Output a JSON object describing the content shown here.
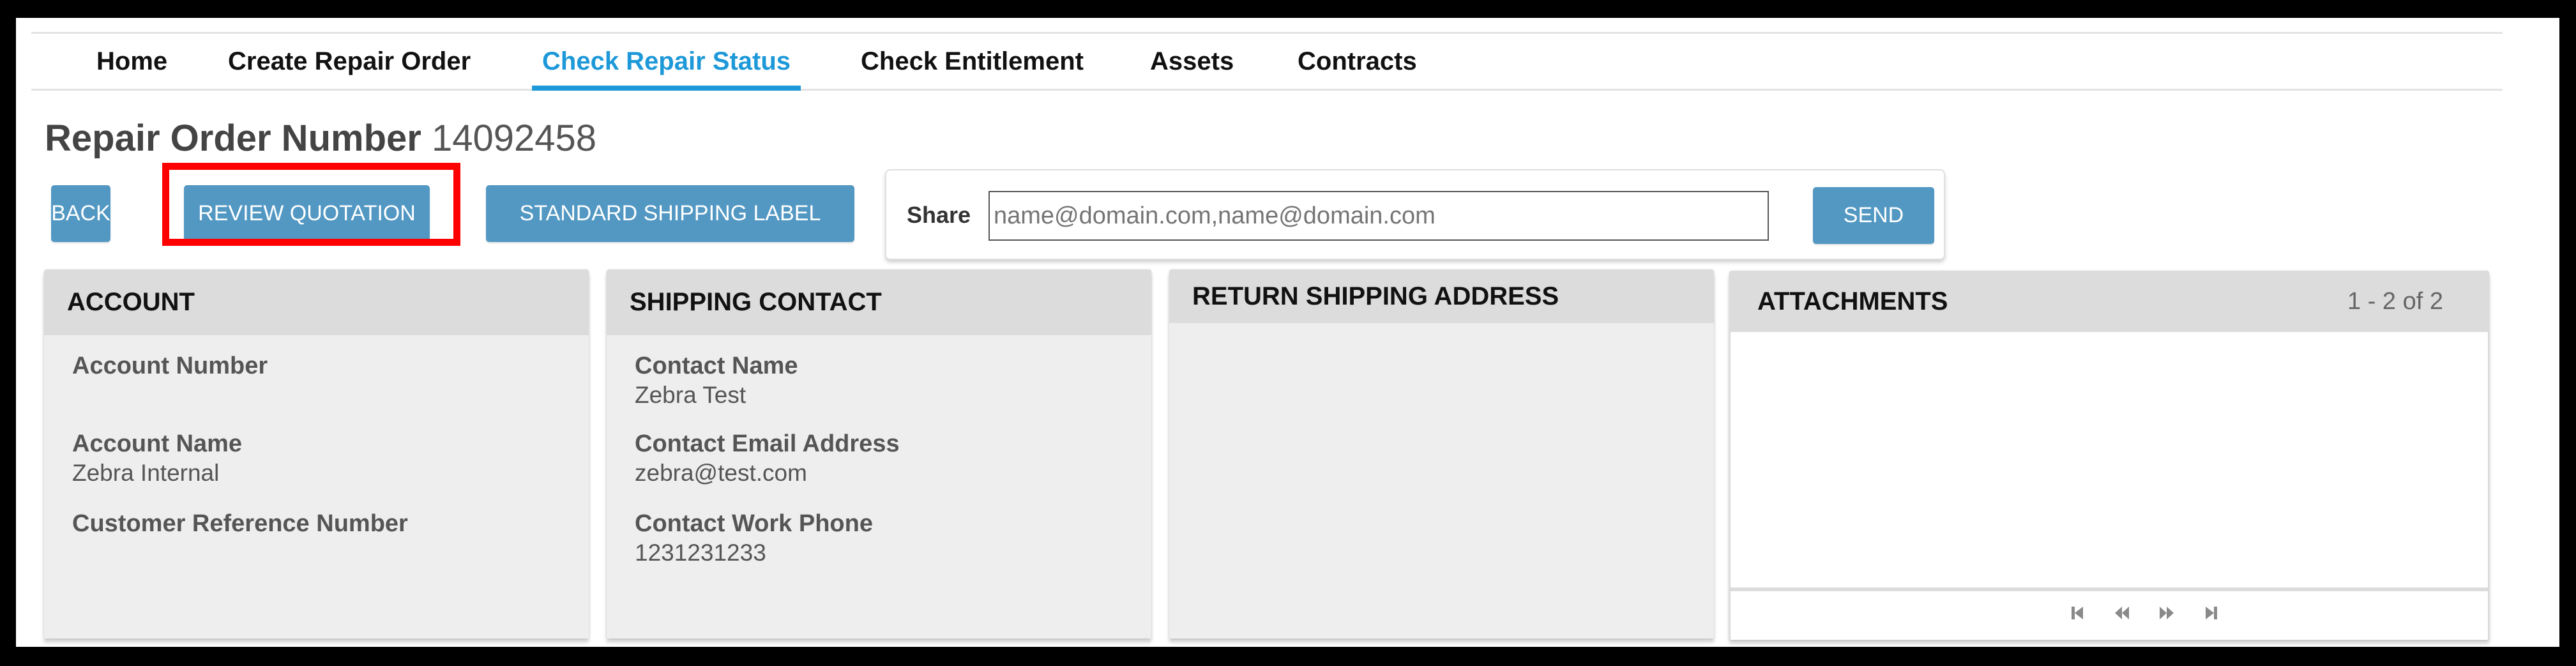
{
  "nav": {
    "items": [
      {
        "label": "Home",
        "active": false
      },
      {
        "label": "Create Repair Order",
        "active": false
      },
      {
        "label": "Check Repair Status",
        "active": true
      },
      {
        "label": "Check Entitlement",
        "active": false
      },
      {
        "label": "Assets",
        "active": false
      },
      {
        "label": "Contracts",
        "active": false
      }
    ]
  },
  "header": {
    "title_label": "Repair Order Number",
    "order_number": "14092458"
  },
  "actions": {
    "back": "BACK",
    "review_quotation": "REVIEW QUOTATION",
    "standard_shipping_label": "STANDARD SHIPPING LABEL"
  },
  "share": {
    "label": "Share",
    "placeholder": "name@domain.com,name@domain.com",
    "value": "",
    "send": "SEND"
  },
  "panels": {
    "account": {
      "title": "ACCOUNT",
      "fields": [
        {
          "label": "Account Number",
          "value": ""
        },
        {
          "label": "Account Name",
          "value": "Zebra Internal"
        },
        {
          "label": "Customer Reference Number",
          "value": ""
        }
      ]
    },
    "shipping_contact": {
      "title": "SHIPPING CONTACT",
      "fields": [
        {
          "label": "Contact Name",
          "value": "Zebra Test"
        },
        {
          "label": "Contact Email Address",
          "value": "zebra@test.com"
        },
        {
          "label": "Contact Work Phone",
          "value": "1231231233"
        }
      ]
    },
    "return_shipping_address": {
      "title": "RETURN SHIPPING ADDRESS"
    },
    "attachments": {
      "title": "ATTACHMENTS",
      "count": "1 - 2 of 2",
      "pager": [
        "first-page-icon",
        "prev-page-icon",
        "next-page-icon",
        "last-page-icon"
      ]
    }
  },
  "colors": {
    "accent": "#1d98d8",
    "button": "#5298c3",
    "highlight": "#ff0000",
    "panel_header": "#dcdcdc",
    "panel_body": "#eeeeee"
  }
}
